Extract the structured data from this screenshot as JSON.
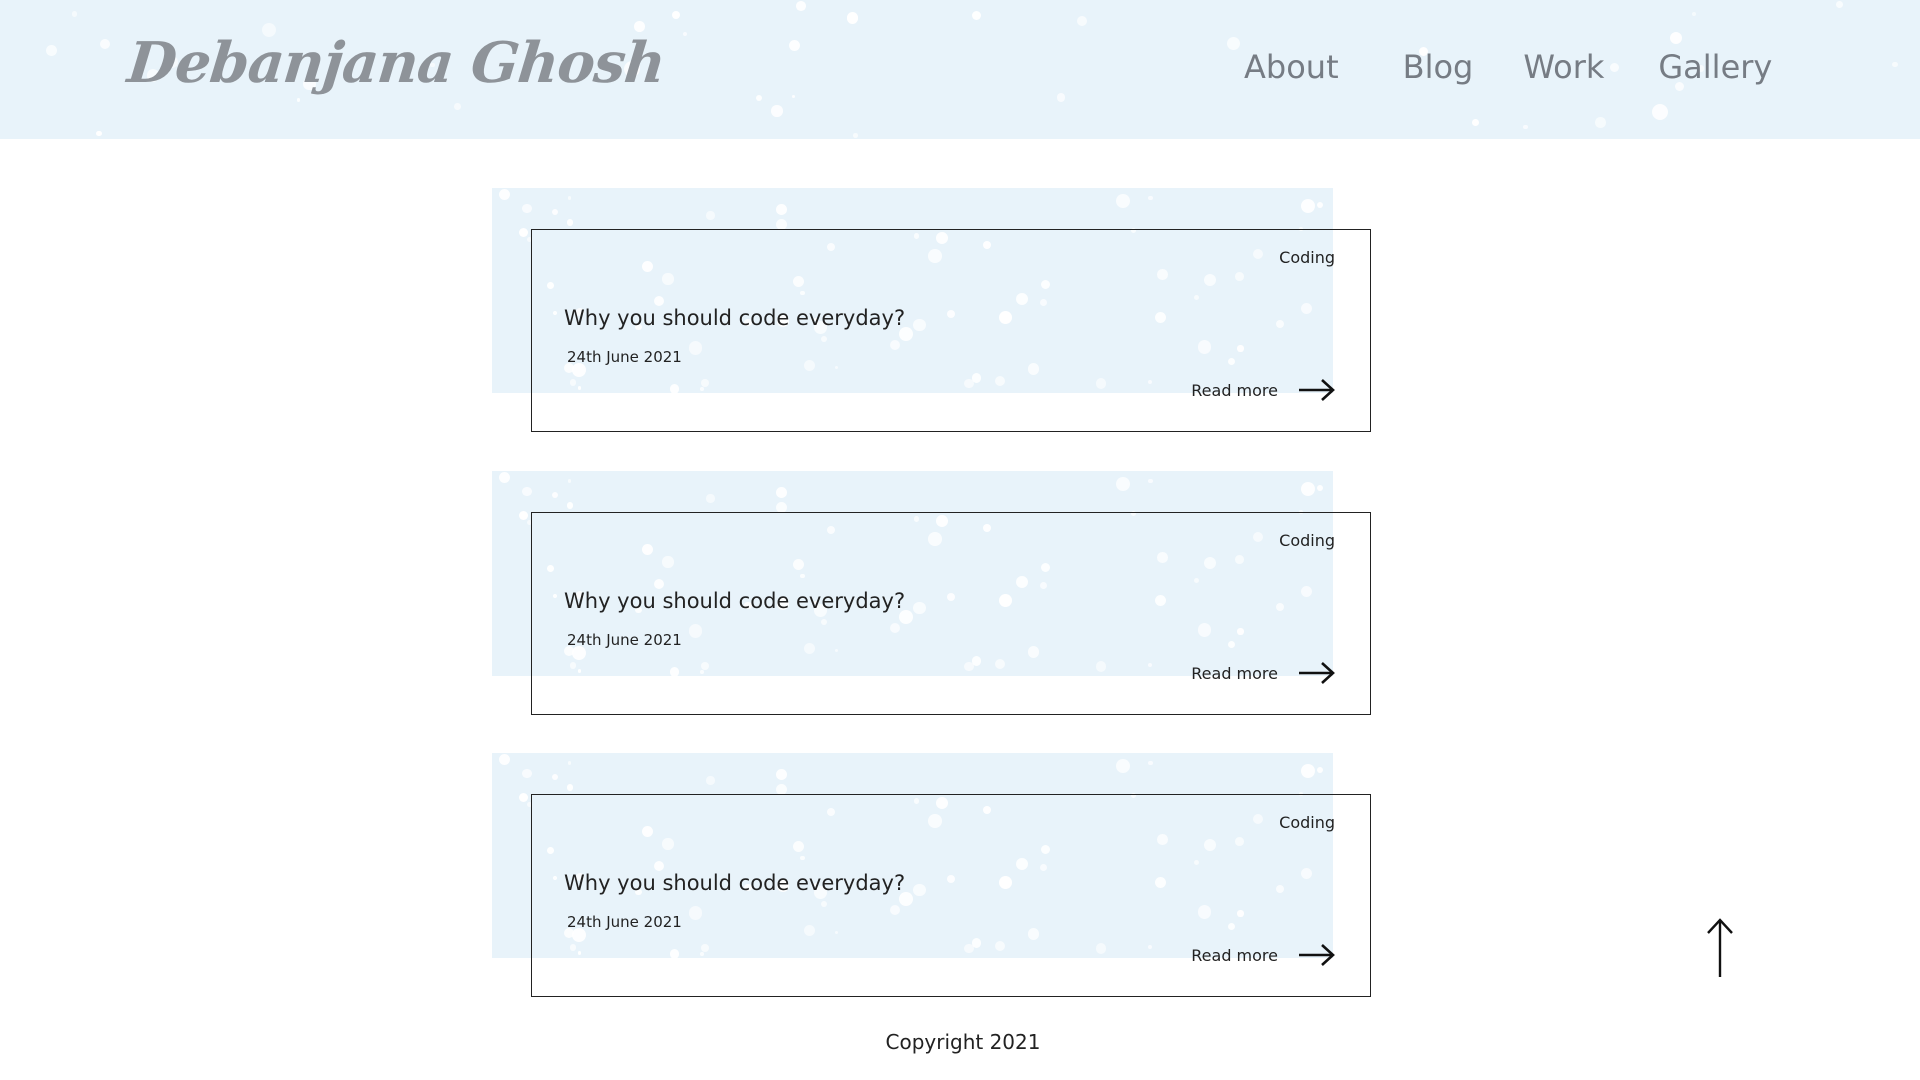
{
  "header": {
    "logo": "Debanjana Ghosh",
    "nav": [
      {
        "label": "About"
      },
      {
        "label": "Blog"
      },
      {
        "label": "Work"
      },
      {
        "label": "Gallery"
      }
    ]
  },
  "posts": [
    {
      "tag": "Coding",
      "title": "Why you should code everyday?",
      "date": "24th June 2021",
      "read_more": "Read more"
    },
    {
      "tag": "Coding",
      "title": "Why you should code everyday?",
      "date": "24th June 2021",
      "read_more": "Read more"
    },
    {
      "tag": "Coding",
      "title": "Why you should code everyday?",
      "date": "24th June 2021",
      "read_more": "Read more"
    }
  ],
  "footer": {
    "copyright": "Copyright 2021"
  },
  "icons": {
    "read_more": "arrow-right-icon",
    "back_to_top": "arrow-up-icon"
  },
  "colors": {
    "header_bg": "#e8f3fa",
    "logo": "#8e9399",
    "nav_text": "#767c84",
    "card_border": "#222222"
  }
}
